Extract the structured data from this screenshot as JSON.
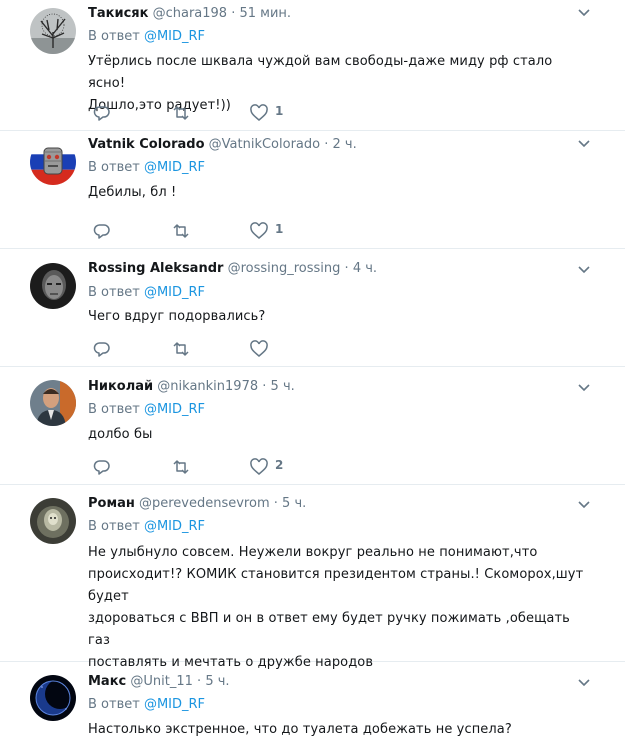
{
  "tweets": [
    {
      "name": "Такисяк",
      "handle": "@chara198",
      "time": "51 мин.",
      "reply_label": "В ответ",
      "reply_to": "@MID_RF",
      "text": "Утёрлись после шквала чуждой вам свободы-даже миду рф стало ясно!\nДошло,это радует!))",
      "likes": "1",
      "avatar_icon": "tree-avatar"
    },
    {
      "name": "Vatnik Colorado",
      "handle": "@VatnikColorado",
      "time": "2 ч.",
      "reply_label": "В ответ",
      "reply_to": "@MID_RF",
      "text": "Дебилы, бл  !",
      "likes": "1",
      "avatar_icon": "vatnik-flag-avatar"
    },
    {
      "name": "Rossing Aleksandr",
      "handle": "@rossing_rossing",
      "time": "4 ч.",
      "reply_label": "В ответ",
      "reply_to": "@MID_RF",
      "text": "Чего вдруг подорвались?",
      "likes": "",
      "avatar_icon": "portrait-avatar"
    },
    {
      "name": "Николай",
      "handle": "@nikankin1978",
      "time": "5 ч.",
      "reply_label": "В ответ",
      "reply_to": "@MID_RF",
      "text": "долбо  бы",
      "likes": "2",
      "avatar_icon": "person-photo-avatar"
    },
    {
      "name": "Роман",
      "handle": "@perevedensevrom",
      "time": "5 ч.",
      "reply_label": "В ответ",
      "reply_to": "@MID_RF",
      "text": "Не улыбнуло совсем. Неужели вокруг реально не понимают,что\nпроисходит!? КОМИК становится президентом страны.! Скоморох,шут будет\nздороваться с ВВП и он в ответ ему будет  ручку пожимать  ,обещать газ\nпоставлять и мечтать о дружбе народов",
      "likes": "",
      "avatar_icon": "hedgehog-fog-avatar"
    },
    {
      "name": "Макс",
      "handle": "@Unit_11",
      "time": "5 ч.",
      "reply_label": "В ответ",
      "reply_to": "@MID_RF",
      "text": "Настолько экстренное, что до туалета добежать не успела?",
      "likes": "",
      "avatar_icon": "moon-avatar"
    }
  ],
  "colors": {
    "name": "#14171a",
    "secondary": "#657786",
    "mention": "#1b95e0",
    "divider": "#e6ecf0"
  }
}
